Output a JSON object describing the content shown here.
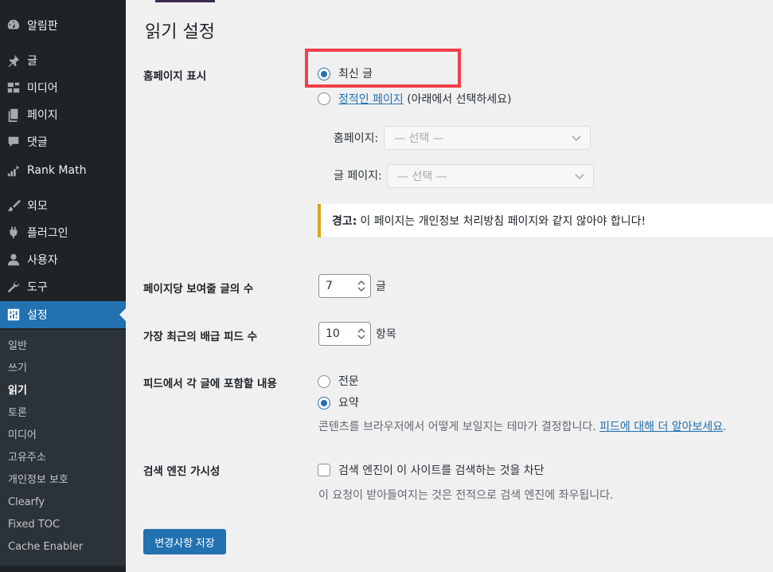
{
  "sidebar": {
    "menu": [
      {
        "label": "알림판",
        "icon": "dashboard-icon"
      },
      {
        "label": "글",
        "icon": "pin-icon"
      },
      {
        "label": "미디어",
        "icon": "media-icon"
      },
      {
        "label": "페이지",
        "icon": "page-icon"
      },
      {
        "label": "댓글",
        "icon": "comment-icon"
      },
      {
        "label": "Rank Math",
        "icon": "rank-math-icon"
      },
      {
        "label": "외모",
        "icon": "brush-icon"
      },
      {
        "label": "플러그인",
        "icon": "plugin-icon"
      },
      {
        "label": "사용자",
        "icon": "user-icon"
      },
      {
        "label": "도구",
        "icon": "wrench-icon"
      },
      {
        "label": "설정",
        "icon": "settings-icon"
      }
    ],
    "submenu": [
      "일반",
      "쓰기",
      "읽기",
      "토론",
      "미디어",
      "고유주소",
      "개인정보 보호",
      "Clearfy",
      "Fixed TOC",
      "Cache Enabler"
    ]
  },
  "page": {
    "title": "읽기 설정",
    "homepage_display": {
      "label": "홈페이지 표시",
      "option_latest": "최신 글",
      "option_static_link": "정적인 페이지",
      "option_static_suffix": "(아래에서 선택하세요)",
      "homepage_label": "홈페이지:",
      "homepage_select": "— 선택 —",
      "posts_page_label": "글 페이지:",
      "posts_page_select": "— 선택 —",
      "warning_bold": "경고:",
      "warning_text": "이 페이지는 개인정보 처리방침 페이지와 같지 않아야 합니다!"
    },
    "posts_per_page": {
      "label": "페이지당 보여줄 글의 수",
      "value": "7",
      "unit": "글"
    },
    "feed_items": {
      "label": "가장 최근의 배급 피드 수",
      "value": "10",
      "unit": "항목"
    },
    "feed_content": {
      "label": "피드에서 각 글에 포함할 내용",
      "option_full": "전문",
      "option_summary": "요약",
      "description": "콘텐츠를 브라우저에서 어떻게 보일지는 테마가 결정합니다.",
      "description_link": "피드에 대해 더 알아보세요"
    },
    "search_visibility": {
      "label": "검색 엔진 가시성",
      "checkbox_label": "검색 엔진이 이 사이트를 검색하는 것을 차단",
      "description": "이 요청이 받아들여지는 것은 전적으로 검색 엔진에 좌우됩니다."
    },
    "save_button": "변경사항 저장"
  },
  "colors": {
    "sidebar_bg": "#1d2327",
    "accent": "#2271b1",
    "highlight": "#f2404a",
    "warning_border": "#dba617"
  }
}
